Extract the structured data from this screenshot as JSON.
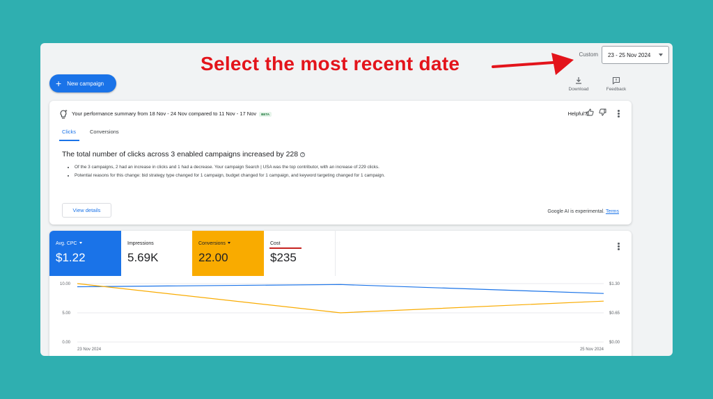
{
  "annotation": {
    "text": "Select the most recent date"
  },
  "date_range": {
    "label": "Custom",
    "value": "23 - 25 Nov 2024"
  },
  "toolbar": {
    "new_campaign_label": "New campaign",
    "download_label": "Download",
    "feedback_label": "Feedback"
  },
  "summary": {
    "heading": "Your performance summary from 18 Nov - 24 Nov compared to 11 Nov - 17 Nov",
    "badge": "BETA",
    "helpful_label": "Helpful?",
    "tabs": [
      {
        "label": "Clicks"
      },
      {
        "label": "Conversions"
      }
    ],
    "title": "The total number of clicks across 3 enabled campaigns increased by 228",
    "bullets": [
      "Of the 3 campaigns, 2 had an increase in clicks and 1 had a decrease. Your campaign Search | USA was the top contributor, with an increase of 229 clicks.",
      "Potential reasons for this change: bid strategy type changed for 1 campaign, budget changed for 1 campaign, and keyword targeting changed for 1 campaign."
    ],
    "view_details_label": "View details",
    "ai_note": "Google AI is experimental.",
    "terms_label": "Terms"
  },
  "metrics": [
    {
      "label": "Avg. CPC",
      "value": "$1.22"
    },
    {
      "label": "Impressions",
      "value": "5.69K"
    },
    {
      "label": "Conversions",
      "value": "22.00"
    },
    {
      "label": "Cost",
      "value": "$235"
    }
  ],
  "colors": {
    "accent_blue": "#1a73e8",
    "accent_yellow": "#f9ab00",
    "annotation_red": "#e3141b",
    "background": "#2fafb0"
  },
  "chart_data": {
    "type": "line",
    "x": [
      "23 Nov 2024",
      "24 Nov 2024",
      "25 Nov 2024"
    ],
    "x_tick_labels": [
      "23 Nov 2024",
      "25 Nov 2024"
    ],
    "left_axis_ticks": [
      "10.00",
      "5.00",
      "0.00"
    ],
    "right_axis_ticks": [
      "$1.30",
      "$0.65",
      "$0.00"
    ],
    "ylim_left": [
      0,
      10
    ],
    "ylim_right": [
      0,
      1.3
    ],
    "series": [
      {
        "name": "Avg. CPC",
        "axis": "right",
        "color": "#1a73e8",
        "values": [
          1.23,
          1.28,
          1.08
        ]
      },
      {
        "name": "Conversions",
        "axis": "left",
        "color": "#f9ab00",
        "values": [
          10,
          5,
          7
        ]
      }
    ],
    "grid": true
  }
}
